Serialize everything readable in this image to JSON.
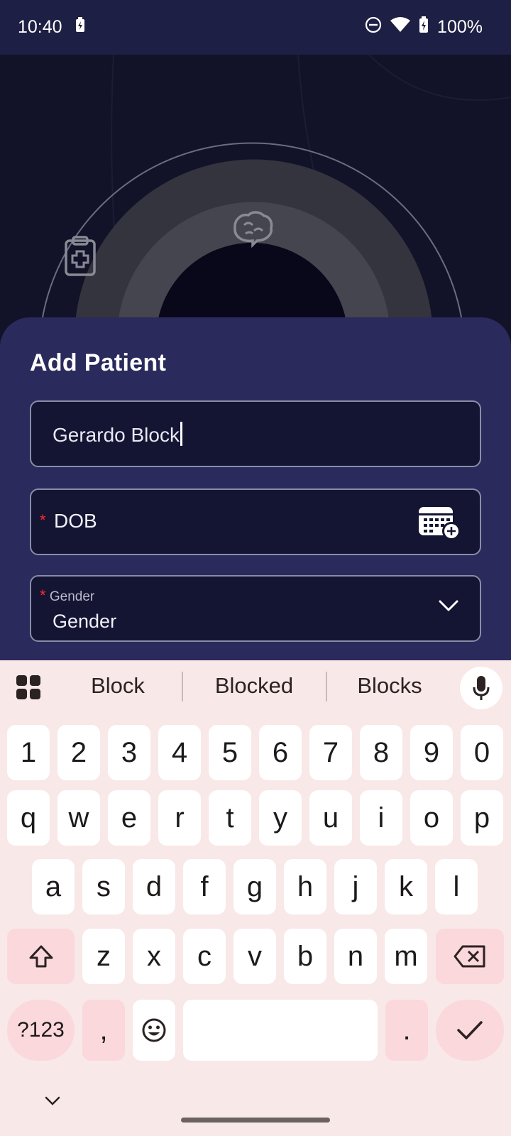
{
  "status_bar": {
    "time": "10:40",
    "battery_text": "100%",
    "icons": [
      "battery-charging-icon",
      "do-not-disturb-icon",
      "wifi-icon",
      "battery-icon"
    ]
  },
  "hero": {
    "icons": [
      "clipboard-plus-icon",
      "brain-icon"
    ]
  },
  "sheet": {
    "title": "Add Patient",
    "name_field": {
      "value": "Gerardo Block"
    },
    "dob_field": {
      "required_mark": "*",
      "label": "DOB",
      "icon": "calendar-add-icon"
    },
    "gender_field": {
      "required_mark": "*",
      "floating_label": "Gender",
      "value": "Gender",
      "icon": "chevron-down-icon"
    }
  },
  "keyboard": {
    "suggestions": [
      "Block",
      "Blocked",
      "Blocks"
    ],
    "number_row": [
      "1",
      "2",
      "3",
      "4",
      "5",
      "6",
      "7",
      "8",
      "9",
      "0"
    ],
    "row1": [
      "q",
      "w",
      "e",
      "r",
      "t",
      "y",
      "u",
      "i",
      "o",
      "p"
    ],
    "row2": [
      "a",
      "s",
      "d",
      "f",
      "g",
      "h",
      "j",
      "k",
      "l"
    ],
    "row3": [
      "z",
      "x",
      "c",
      "v",
      "b",
      "n",
      "m"
    ],
    "symbols_label": "?123",
    "comma": ",",
    "period": ".",
    "colors": {
      "background": "#f9e8e8",
      "key": "#ffffff",
      "special_key": "#fbd8dc"
    }
  },
  "colors": {
    "sheet_bg": "#2a2a5c",
    "field_bg": "#141433",
    "required": "#ff2a2a",
    "status_bar_bg": "#1e1f44"
  }
}
